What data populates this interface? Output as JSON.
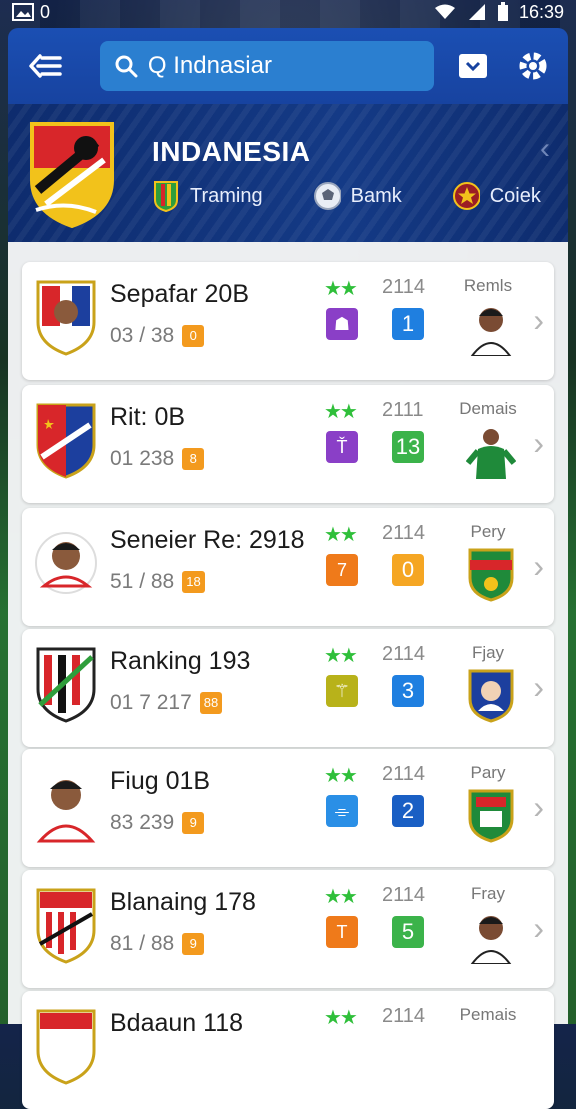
{
  "status_bar": {
    "time": "16:39",
    "indicator": "0"
  },
  "search": {
    "value": "Q Indnasiar"
  },
  "team": {
    "name": "INDANESIA",
    "tabs": [
      {
        "label": "Traming",
        "icon": "flag-badge-icon"
      },
      {
        "label": "Bamk",
        "icon": "ball-icon"
      },
      {
        "label": "Coiek",
        "icon": "star-crest-icon"
      }
    ]
  },
  "cards": [
    {
      "title": "Sepafar 20B",
      "sub": "03 / 38",
      "chip": "0",
      "stars": "★★",
      "score": "2114",
      "pos_color": "#8a3fc7",
      "pos_glyph": "☗",
      "num": "1",
      "num_color": "#1f7fe0",
      "right_label": "Remls"
    },
    {
      "title": "Rit: 0B",
      "sub": "01 238",
      "chip": "8",
      "stars": "★★",
      "score": "2111",
      "pos_color": "#8a3fc7",
      "pos_glyph": "Ť",
      "num": "13",
      "num_color": "#3bb34a",
      "right_label": "Demais"
    },
    {
      "title": "Seneier Re: 2918",
      "sub": "51 / 88",
      "chip": "18",
      "stars": "★★",
      "score": "2114",
      "pos_color": "#ef7a1a",
      "pos_glyph": "7",
      "num": "0",
      "num_color": "#f5a623",
      "right_label": "Pery"
    },
    {
      "title": "Ranking 193",
      "sub": "01 7 217",
      "chip": "88",
      "stars": "★★",
      "score": "2114",
      "pos_color": "#b8b21a",
      "pos_glyph": "⚚",
      "num": "3",
      "num_color": "#1f7fe0",
      "right_label": "Fjay"
    },
    {
      "title": "Fiug 01B",
      "sub": "83 239",
      "chip": "9",
      "stars": "★★",
      "score": "2114",
      "pos_color": "#2a8fe6",
      "pos_glyph": "⌯",
      "num": "2",
      "num_color": "#1a5fc4",
      "right_label": "Pary"
    },
    {
      "title": "Blanaing 178",
      "sub": "81 / 88",
      "chip": "9",
      "stars": "★★",
      "score": "2114",
      "pos_color": "#ef7a1a",
      "pos_glyph": "T",
      "num": "5",
      "num_color": "#3bb34a",
      "right_label": "Fray"
    },
    {
      "title": "Bdaaun 118",
      "sub": "",
      "chip": "",
      "stars": "★★",
      "score": "2114",
      "pos_color": "#ef7a1a",
      "pos_glyph": "",
      "num": "",
      "num_color": "#3bb34a",
      "right_label": "Pemais"
    }
  ]
}
